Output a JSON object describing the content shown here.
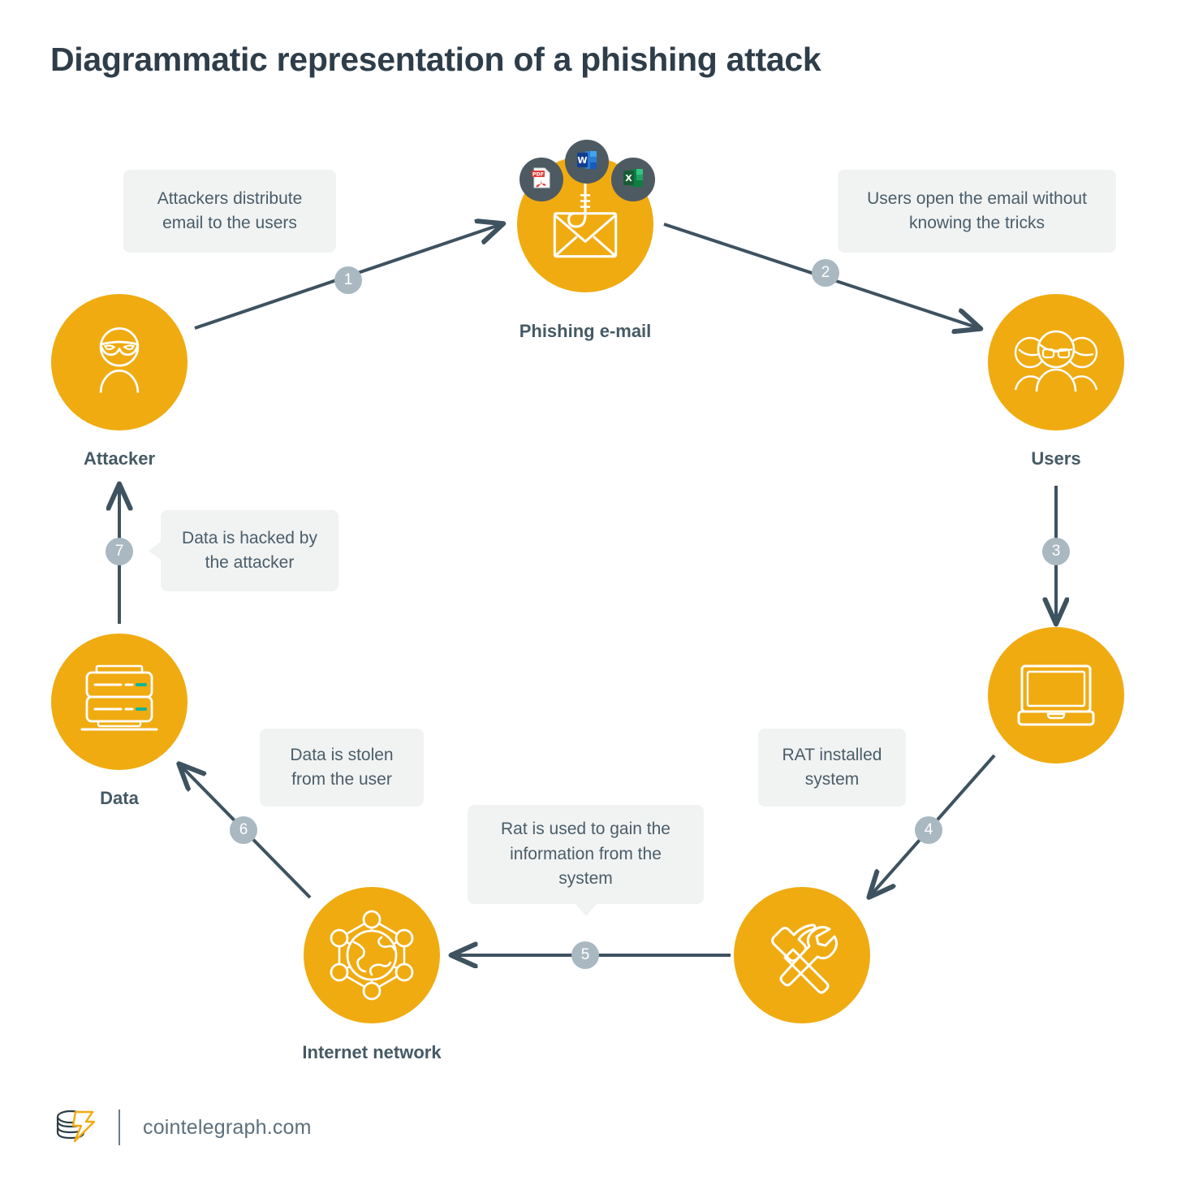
{
  "page": {
    "title": "Diagrammatic representation of a phishing attack",
    "background": "#ffffff",
    "accent_color": "#f0ab11",
    "text_color": "#465a65",
    "callout_bg": "#f1f3f2",
    "badge_color": "#a9b8c1",
    "connector_color": "#3e5260"
  },
  "nodes": [
    {
      "id": "attacker",
      "label": "Attacker",
      "icon": "masked-person-icon"
    },
    {
      "id": "email",
      "label": "Phishing e-mail",
      "icon": "envelope-hook-icon"
    },
    {
      "id": "users",
      "label": "Users",
      "icon": "group-of-people-icon"
    },
    {
      "id": "laptop",
      "label": "",
      "icon": "laptop-icon"
    },
    {
      "id": "tools",
      "label": "",
      "icon": "hammer-wrench-icon"
    },
    {
      "id": "network",
      "label": "Internet network",
      "icon": "globe-network-icon"
    },
    {
      "id": "data",
      "label": "Data",
      "icon": "server-database-icon"
    }
  ],
  "attachments": [
    {
      "id": "pdf",
      "label": "PDF",
      "icon": "pdf-file-icon"
    },
    {
      "id": "word",
      "label": "W",
      "icon": "word-file-icon"
    },
    {
      "id": "excel",
      "label": "X",
      "icon": "excel-file-icon"
    }
  ],
  "steps": [
    {
      "number": "1",
      "text": "Attackers distribute email to the users"
    },
    {
      "number": "2",
      "text": "Users open the email without knowing the tricks"
    },
    {
      "number": "3",
      "text": ""
    },
    {
      "number": "4",
      "text": "RAT installed system"
    },
    {
      "number": "5",
      "text": "Rat is used to gain the information from the system"
    },
    {
      "number": "6",
      "text": "Data is stolen from the user"
    },
    {
      "number": "7",
      "text": "Data is hacked by the attacker"
    }
  ],
  "callouts": {
    "step1": "Attackers distribute email to the users",
    "step2": "Users open the email without knowing the tricks",
    "step4": "RAT installed system",
    "step5": "Rat is used to gain the information from the system",
    "step6": "Data is stolen from the user",
    "step7": "Data is hacked by the attacker"
  },
  "footer": {
    "site": "cointelegraph.com",
    "logo": "cointelegraph-logo-icon"
  }
}
